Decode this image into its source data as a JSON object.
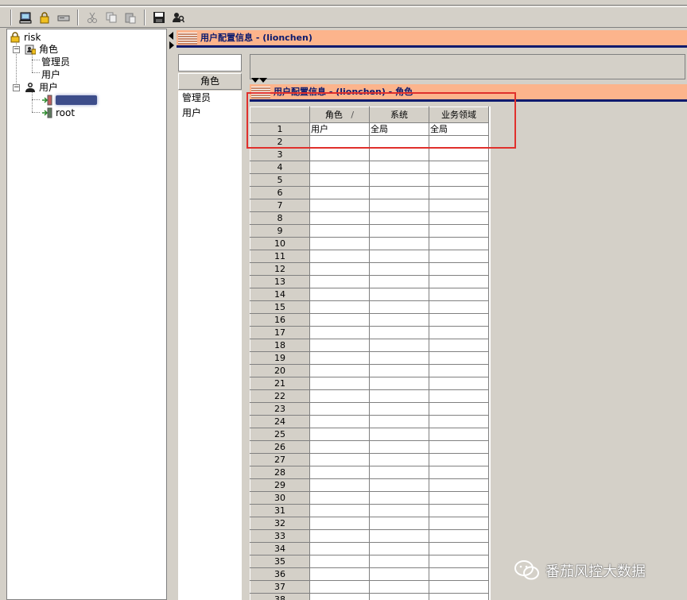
{
  "toolbar": {
    "buttons": [
      "computer-icon",
      "lock-icon",
      "drive-icon",
      "cut-icon",
      "copy-icon",
      "paste-icon",
      "save-icon",
      "user-search-icon"
    ]
  },
  "tree": {
    "root_label": "risk",
    "roles_label": "角色",
    "role_children": [
      "管理员",
      "用户"
    ],
    "users_label": "用户",
    "user_children": [
      "",
      "root"
    ]
  },
  "main": {
    "section_title": "用户配置信息 - (lionchen)",
    "role_panel": {
      "column_header": "角色",
      "items": [
        "管理员",
        "用户"
      ]
    },
    "subsection_title": "用户配置信息 - (lionchen) - 角色",
    "grid": {
      "columns": [
        "角色",
        "系统",
        "业务领域"
      ],
      "sort_indicator": "/",
      "rows": [
        [
          "用户",
          "全局",
          "全局"
        ]
      ],
      "row_count_visible": 38
    }
  },
  "watermark": {
    "text": "番茄风控大数据"
  },
  "colors": {
    "header_bg": "#fcb48c",
    "header_text": "#0b1a6e",
    "highlight": "#e0302c"
  }
}
